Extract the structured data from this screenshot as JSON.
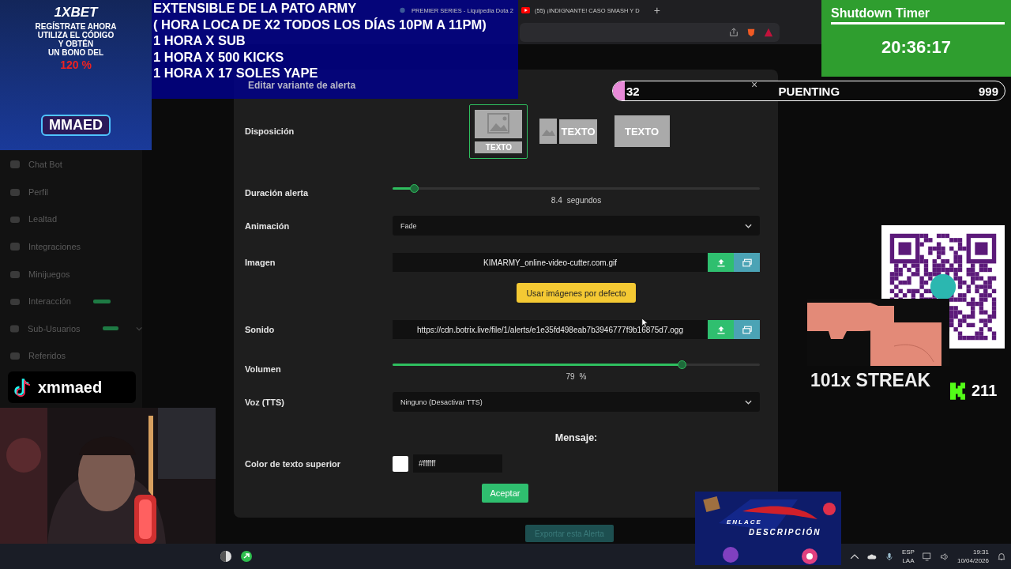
{
  "browser": {
    "tabs": [
      {
        "title": "PREMIER SERIES - Liquipedia Dota 2",
        "kind": "site"
      },
      {
        "title": "(55) ¡INDIGNANTE! CASO SMASH Y D",
        "kind": "video"
      }
    ],
    "new_tab": "+"
  },
  "sidebar": {
    "items": [
      {
        "label": "Chat Bot",
        "badge": false,
        "expandable": false
      },
      {
        "label": "Perfil",
        "badge": false,
        "expandable": false
      },
      {
        "label": "Lealtad",
        "badge": false,
        "expandable": false
      },
      {
        "label": "Integraciones",
        "badge": false,
        "expandable": false
      },
      {
        "label": "Minijuegos",
        "badge": false,
        "expandable": false
      },
      {
        "label": "Interacción",
        "badge": true,
        "expandable": false
      },
      {
        "label": "Sub-Usuarios",
        "badge": true,
        "expandable": true
      },
      {
        "label": "Referidos",
        "badge": false,
        "expandable": false
      }
    ]
  },
  "modal": {
    "title": "Editar variante de alerta",
    "rows": [
      {
        "kind": "layout",
        "label": "Disposición",
        "options": [
          {
            "kind": "stacked",
            "text": "TEXTO",
            "selected": true
          },
          {
            "kind": "side",
            "text": "TEXTO",
            "selected": false
          },
          {
            "kind": "overlay",
            "text": "TEXTO",
            "selected": false
          }
        ]
      },
      {
        "kind": "slider",
        "label": "Duración alerta",
        "level": 0.06,
        "reading": "8.4",
        "unit": "segundos"
      },
      {
        "kind": "select",
        "label": "Animación",
        "value": "Fade"
      },
      {
        "kind": "file",
        "label": "Imagen",
        "value": "KIMARMY_online-video-cutter.com.gif"
      },
      {
        "kind": "action",
        "text": "Usar imágenes por defecto"
      },
      {
        "kind": "file",
        "label": "Sonido",
        "value": "https://cdn.botrix.live/file/1/alerts/e1e35fd498eab7b3946777f9b16875d7.ogg"
      },
      {
        "kind": "slider",
        "label": "Volumen",
        "level": 0.79,
        "reading": "79",
        "unit": "%"
      },
      {
        "kind": "select",
        "label": "Voz (TTS)",
        "value": "Ninguno (Desactivar TTS)"
      },
      {
        "kind": "heading",
        "text": "Mensaje:"
      },
      {
        "kind": "color",
        "label": "Color de texto superior",
        "value": "#ffffff"
      }
    ],
    "accept": "Aceptar"
  },
  "export_button": "Exportar esta Alerta",
  "overlays": {
    "ad": {
      "brand": "1XBET",
      "lines": [
        "REGÍSTRATE AHORA",
        "UTILIZA EL CÓDIGO",
        "Y OBTÉN",
        "UN BONO DEL"
      ],
      "bonus": "120 %",
      "code": "MMAED"
    },
    "banner": {
      "lines": [
        "EXTENSIBLE  DE LA PATO ARMY",
        "( HORA LOCA DE X2 TODOS LOS DÍAS 10PM A 11PM)",
        "1 HORA X SUB",
        "1 HORA X 500 KICKS",
        "1 HORA X 17 SOLES YAPE"
      ]
    },
    "timer": {
      "title": "Shutdown Timer",
      "time": "20:36:17"
    },
    "goal_bar": {
      "current": "32",
      "name": "PUENTING",
      "target": "999",
      "close": "×",
      "level": 0.03
    },
    "tiktok": {
      "handle": "xmmaed"
    },
    "alert": {
      "streak": "101x STREAK",
      "count": "211"
    },
    "promo": {
      "line1": "ENLACE",
      "line2": "DESCRIPCIÓN"
    }
  },
  "taskbar": {
    "language": "ESP",
    "layout": "LAA",
    "time": "19:31",
    "date": "10/04/2026"
  }
}
